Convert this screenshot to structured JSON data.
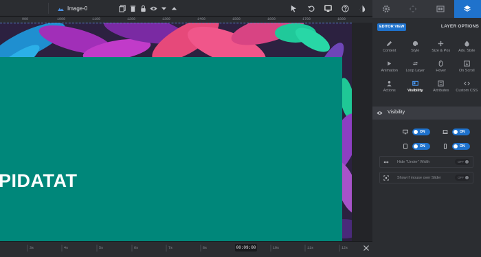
{
  "toolbar": {
    "layer_name": "Image-0"
  },
  "ruler": {
    "labels": [
      "900",
      "1000",
      "1100",
      "1200",
      "1300",
      "1400",
      "1500",
      "1600",
      "1700",
      "1800"
    ]
  },
  "canvas": {
    "headline": "PIDATAT"
  },
  "timeline": {
    "labels": [
      "3s",
      "4s",
      "5s",
      "6s",
      "7s",
      "8s",
      "10s",
      "11s",
      "12s"
    ],
    "timecode": "00:09:00"
  },
  "panel": {
    "editor_view": "EDITOR VIEW",
    "layer_options": "LAYER OPTIONS",
    "options": [
      {
        "label": "Content",
        "icon": "pen-icon"
      },
      {
        "label": "Style",
        "icon": "palette-icon"
      },
      {
        "label": "Size & Pos",
        "icon": "move-icon"
      },
      {
        "label": "Adv. Style",
        "icon": "contrast-icon"
      },
      {
        "label": "Animation",
        "icon": "play-icon"
      },
      {
        "label": "Loop Layer",
        "icon": "loop-icon"
      },
      {
        "label": "Hover",
        "icon": "mouse-icon"
      },
      {
        "label": "On Scroll",
        "icon": "scroll-icon"
      },
      {
        "label": "Actions",
        "icon": "actions-icon"
      },
      {
        "label": "Visibility",
        "icon": "visibility-icon"
      },
      {
        "label": "Attributes",
        "icon": "attributes-icon"
      },
      {
        "label": "Custom CSS",
        "icon": "code-icon"
      }
    ],
    "visibility": {
      "title": "Visibility",
      "on_label": "ON",
      "off_label": "OFF",
      "hide_under_width": "Hide \"Under\" Width",
      "show_if_mouse": "Show if mouse over Slider"
    }
  },
  "colors": {
    "accent": "#1f72cc",
    "teal": "#00877a"
  }
}
